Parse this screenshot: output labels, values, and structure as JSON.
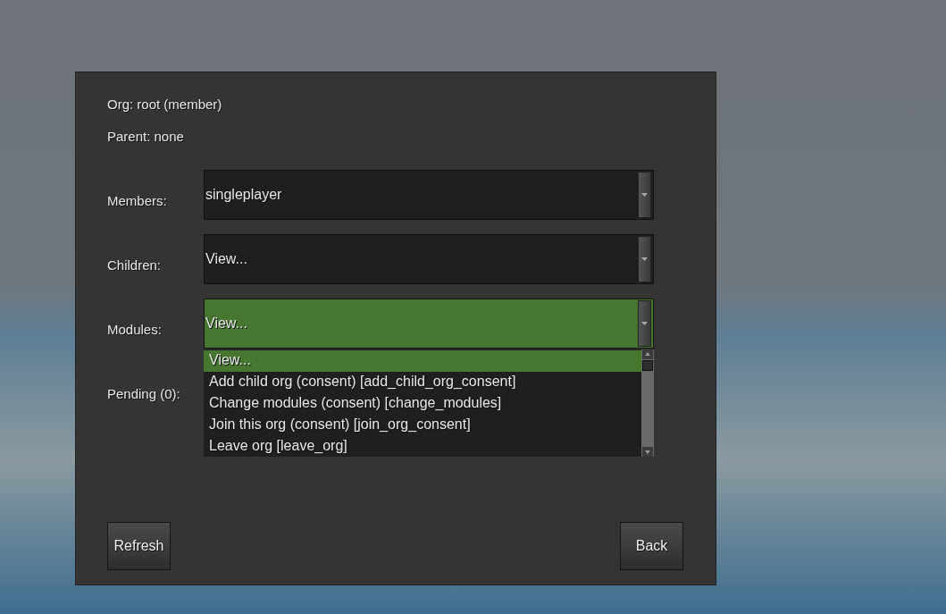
{
  "panel": {
    "org": "Org: root (member)",
    "parent": "Parent: none",
    "dropdowns": [
      {
        "label": "Members:",
        "value": "singleplayer",
        "open": false
      },
      {
        "label": "Children:",
        "value": "View...",
        "open": false
      },
      {
        "label": "Modules:",
        "value": "View...",
        "open": true,
        "options": [
          {
            "text": "View...",
            "selected": true
          },
          {
            "text": "Add child org (consent) [add_child_org_consent]",
            "selected": false
          },
          {
            "text": "Change modules (consent) [change_modules]",
            "selected": false
          },
          {
            "text": "Join this org (consent) [join_org_consent]",
            "selected": false
          },
          {
            "text": "Leave org [leave_org]",
            "selected": false
          }
        ]
      }
    ],
    "pending": {
      "label": "Pending (0):"
    },
    "buttons": [
      "Refresh",
      "Back"
    ]
  }
}
